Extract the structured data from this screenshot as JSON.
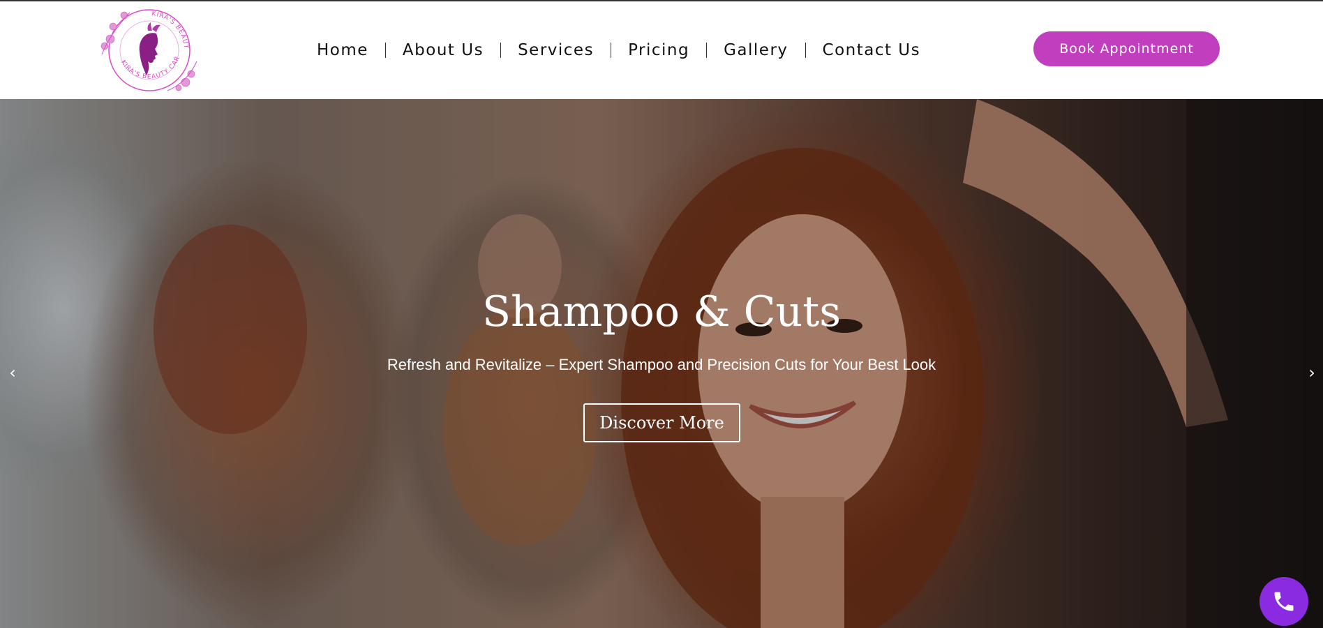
{
  "brand": {
    "logo_text_top": "KIRA'S BEAUTY CARE",
    "logo_text_bottom": "KIRA'S BEAUTY CARE",
    "logo_color": "#d94bc8",
    "logo_icon": "woman-profile-logo"
  },
  "nav": {
    "items": [
      {
        "label": "Home"
      },
      {
        "label": "About Us"
      },
      {
        "label": "Services"
      },
      {
        "label": "Pricing"
      },
      {
        "label": "Gallery"
      },
      {
        "label": "Contact Us"
      }
    ]
  },
  "header": {
    "book_label": "Book Appointment",
    "book_color": "#c13fbf"
  },
  "hero": {
    "title": "Shampoo & Cuts",
    "subtitle": "Refresh and Revitalize – Expert Shampoo and Precision Cuts for Your Best Look",
    "cta_label": "Discover More",
    "prev_icon": "chevron-left-icon",
    "next_icon": "chevron-right-icon",
    "prev_glyph": "‹",
    "next_glyph": "›"
  },
  "floating": {
    "call_icon": "phone-icon",
    "call_color": "#8a2be2"
  }
}
